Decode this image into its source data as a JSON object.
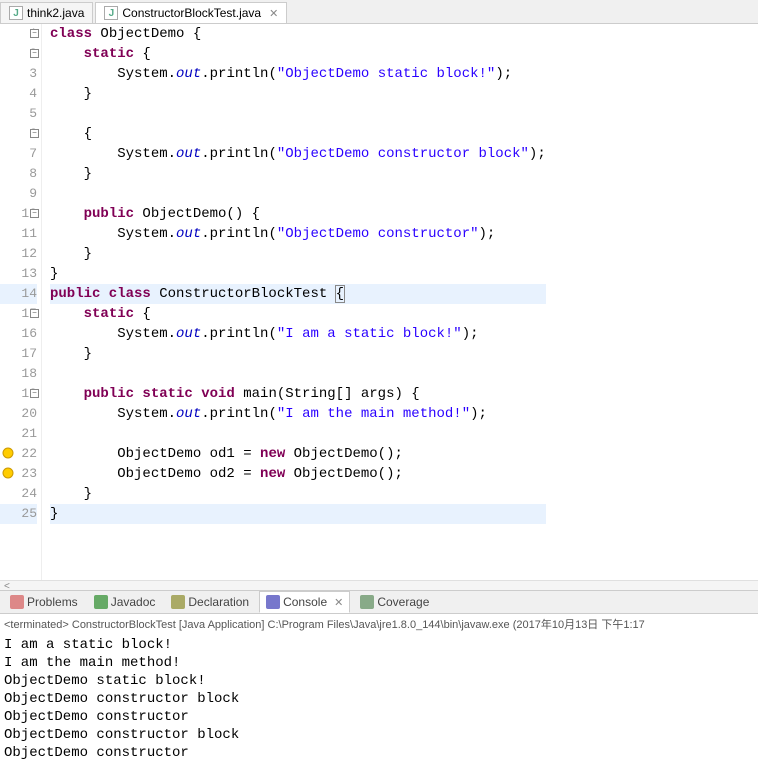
{
  "tabs": [
    {
      "label": "think2.java",
      "icon": "J",
      "active": false
    },
    {
      "label": "ConstructorBlockTest.java",
      "icon": "J",
      "active": true
    }
  ],
  "code_lines": [
    {
      "n": 1,
      "fold": "-",
      "tokens": [
        {
          "t": "class ",
          "c": "kw"
        },
        {
          "t": "ObjectDemo {",
          "c": ""
        }
      ]
    },
    {
      "n": 2,
      "fold": "-",
      "tokens": [
        {
          "t": "    ",
          "c": ""
        },
        {
          "t": "static ",
          "c": "kw"
        },
        {
          "t": "{",
          "c": ""
        }
      ]
    },
    {
      "n": 3,
      "tokens": [
        {
          "t": "        System.",
          "c": ""
        },
        {
          "t": "out",
          "c": "fld"
        },
        {
          "t": ".println(",
          "c": ""
        },
        {
          "t": "\"ObjectDemo static block!\"",
          "c": "str"
        },
        {
          "t": ");",
          "c": ""
        }
      ]
    },
    {
      "n": 4,
      "tokens": [
        {
          "t": "    }",
          "c": ""
        }
      ]
    },
    {
      "n": 5,
      "tokens": [
        {
          "t": "",
          "c": ""
        }
      ]
    },
    {
      "n": 6,
      "fold": "-",
      "tokens": [
        {
          "t": "    {",
          "c": ""
        }
      ]
    },
    {
      "n": 7,
      "tokens": [
        {
          "t": "        System.",
          "c": ""
        },
        {
          "t": "out",
          "c": "fld"
        },
        {
          "t": ".println(",
          "c": ""
        },
        {
          "t": "\"ObjectDemo constructor block\"",
          "c": "str"
        },
        {
          "t": ");",
          "c": ""
        }
      ]
    },
    {
      "n": 8,
      "tokens": [
        {
          "t": "    }",
          "c": ""
        }
      ]
    },
    {
      "n": 9,
      "tokens": [
        {
          "t": "",
          "c": ""
        }
      ]
    },
    {
      "n": 10,
      "fold": "-",
      "tokens": [
        {
          "t": "    ",
          "c": ""
        },
        {
          "t": "public ",
          "c": "kw"
        },
        {
          "t": "ObjectDemo() {",
          "c": ""
        }
      ]
    },
    {
      "n": 11,
      "tokens": [
        {
          "t": "        System.",
          "c": ""
        },
        {
          "t": "out",
          "c": "fld"
        },
        {
          "t": ".println(",
          "c": ""
        },
        {
          "t": "\"ObjectDemo constructor\"",
          "c": "str"
        },
        {
          "t": ");",
          "c": ""
        }
      ]
    },
    {
      "n": 12,
      "tokens": [
        {
          "t": "    }",
          "c": ""
        }
      ]
    },
    {
      "n": 13,
      "tokens": [
        {
          "t": "}",
          "c": ""
        }
      ]
    },
    {
      "n": 14,
      "hl": true,
      "tokens": [
        {
          "t": "public class ",
          "c": "kw"
        },
        {
          "t": "ConstructorBlockTest ",
          "c": ""
        },
        {
          "t": "{",
          "c": "caret-box"
        }
      ]
    },
    {
      "n": 15,
      "fold": "-",
      "tokens": [
        {
          "t": "    ",
          "c": ""
        },
        {
          "t": "static ",
          "c": "kw"
        },
        {
          "t": "{",
          "c": ""
        }
      ]
    },
    {
      "n": 16,
      "tokens": [
        {
          "t": "        System.",
          "c": ""
        },
        {
          "t": "out",
          "c": "fld"
        },
        {
          "t": ".println(",
          "c": ""
        },
        {
          "t": "\"I am a static block!\"",
          "c": "str"
        },
        {
          "t": ");",
          "c": ""
        }
      ]
    },
    {
      "n": 17,
      "tokens": [
        {
          "t": "    }",
          "c": ""
        }
      ]
    },
    {
      "n": 18,
      "tokens": [
        {
          "t": "",
          "c": ""
        }
      ]
    },
    {
      "n": 19,
      "fold": "-",
      "tokens": [
        {
          "t": "    ",
          "c": ""
        },
        {
          "t": "public static void ",
          "c": "kw"
        },
        {
          "t": "main(String[] args) {",
          "c": ""
        }
      ]
    },
    {
      "n": 20,
      "tokens": [
        {
          "t": "        System.",
          "c": ""
        },
        {
          "t": "out",
          "c": "fld"
        },
        {
          "t": ".println(",
          "c": ""
        },
        {
          "t": "\"I am the main method!\"",
          "c": "str"
        },
        {
          "t": ");",
          "c": ""
        }
      ]
    },
    {
      "n": 21,
      "tokens": [
        {
          "t": "",
          "c": ""
        }
      ]
    },
    {
      "n": 22,
      "marker": true,
      "tokens": [
        {
          "t": "        ObjectDemo od1 = ",
          "c": ""
        },
        {
          "t": "new ",
          "c": "kw"
        },
        {
          "t": "ObjectDemo();",
          "c": ""
        }
      ]
    },
    {
      "n": 23,
      "marker": true,
      "tokens": [
        {
          "t": "        ObjectDemo od2 = ",
          "c": ""
        },
        {
          "t": "new ",
          "c": "kw"
        },
        {
          "t": "ObjectDemo();",
          "c": ""
        }
      ]
    },
    {
      "n": 24,
      "tokens": [
        {
          "t": "    }",
          "c": ""
        }
      ]
    },
    {
      "n": 25,
      "hl": true,
      "tokens": [
        {
          "t": "}",
          "c": ""
        }
      ]
    }
  ],
  "bottom_tabs": [
    {
      "label": "Problems",
      "active": false
    },
    {
      "label": "Javadoc",
      "active": false
    },
    {
      "label": "Declaration",
      "active": false
    },
    {
      "label": "Console",
      "active": true
    },
    {
      "label": "Coverage",
      "active": false
    }
  ],
  "console_header": "<terminated> ConstructorBlockTest [Java Application] C:\\Program Files\\Java\\jre1.8.0_144\\bin\\javaw.exe (2017年10月13日 下午1:17",
  "console_output": [
    "I am a static block!",
    "I am the main method!",
    "ObjectDemo static block!",
    "ObjectDemo constructor block",
    "ObjectDemo constructor",
    "ObjectDemo constructor block",
    "ObjectDemo constructor"
  ]
}
